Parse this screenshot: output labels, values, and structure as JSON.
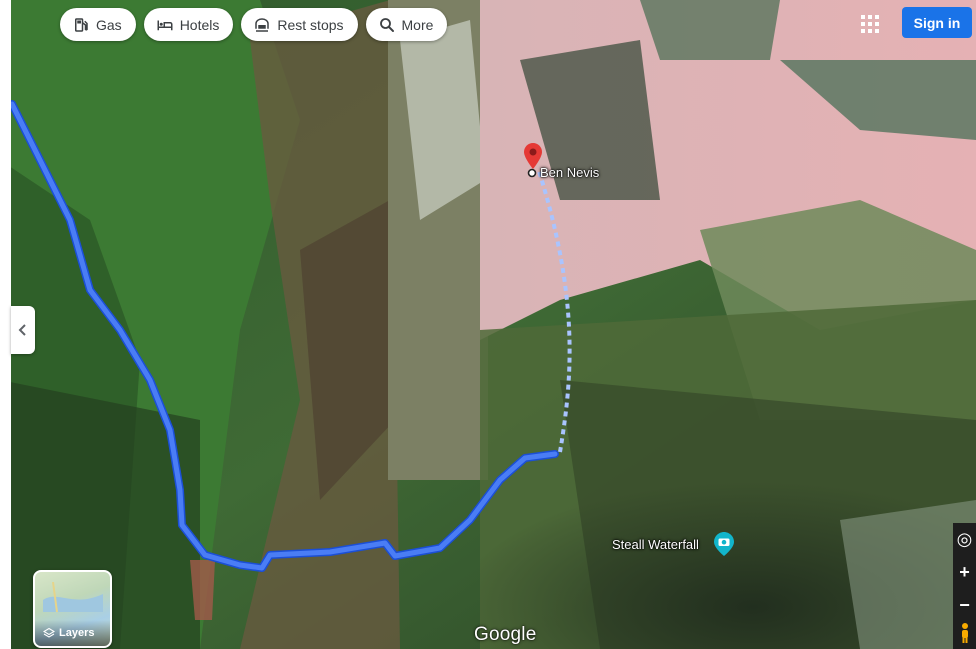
{
  "top_chips": [
    {
      "label": "Gas",
      "icon": "gas-station-icon"
    },
    {
      "label": "Hotels",
      "icon": "bed-icon"
    },
    {
      "label": "Rest stops",
      "icon": "rest-stop-icon"
    },
    {
      "label": "More",
      "icon": "search-icon"
    }
  ],
  "header": {
    "signin_label": "Sign in",
    "apps_icon": "apps-grid-icon"
  },
  "places": {
    "summit": {
      "name": "Ben Nevis",
      "icon": "red-pin-icon"
    },
    "poi": {
      "name": "Steall Waterfall",
      "icon": "camera-icon"
    }
  },
  "layers": {
    "label": "Layers",
    "icon": "layers-icon"
  },
  "map_controls": [
    {
      "name": "my-location-button",
      "symbol": "◎"
    },
    {
      "name": "zoom-in-button",
      "symbol": "+"
    },
    {
      "name": "zoom-out-button",
      "symbol": "−"
    }
  ],
  "brand": {
    "logo": "Google"
  },
  "colors": {
    "route": "#3b6cf0",
    "route_walk": "#a9c4ff",
    "signin": "#1a73e8",
    "pin": "#e53935"
  }
}
